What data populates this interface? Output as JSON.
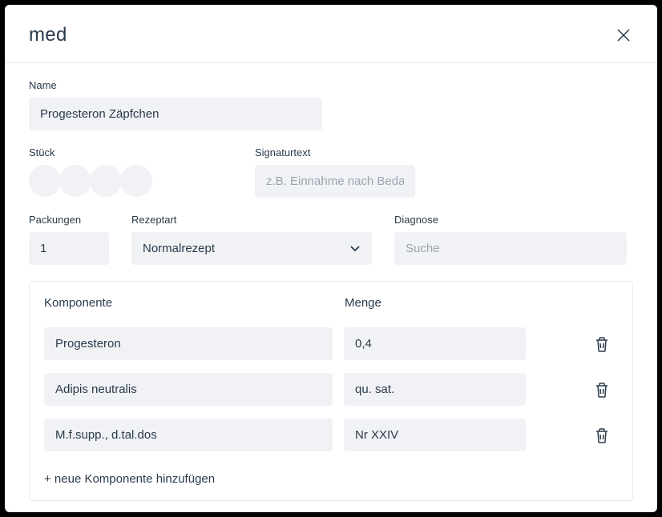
{
  "dialog": {
    "title": "med"
  },
  "fields": {
    "name": {
      "label": "Name",
      "value": "Progesteron Zäpfchen"
    },
    "stueck": {
      "label": "Stück"
    },
    "signaturtext": {
      "label": "Signaturtext",
      "placeholder": "z.B. Einnahme nach Bedarf",
      "value": ""
    },
    "packungen": {
      "label": "Packungen",
      "value": "1"
    },
    "rezeptart": {
      "label": "Rezeptart",
      "value": "Normalrezept"
    },
    "diagnose": {
      "label": "Diagnose",
      "placeholder": "Suche",
      "value": ""
    }
  },
  "table": {
    "headers": {
      "komponente": "Komponente",
      "menge": "Menge"
    },
    "rows": [
      {
        "komponente": "Progesteron",
        "menge": "0,4"
      },
      {
        "komponente": "Adipis neutralis",
        "menge": "qu. sat."
      },
      {
        "komponente": "M.f.supp., d.tal.dos",
        "menge": "Nr XXIV"
      }
    ],
    "add_label": "+ neue Komponente hinzufügen"
  }
}
